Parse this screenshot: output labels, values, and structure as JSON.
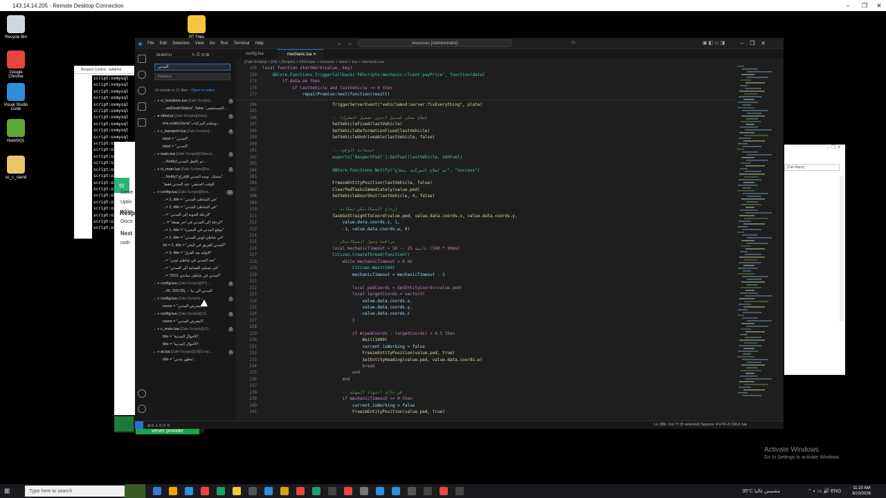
{
  "rdp": {
    "title": "143.14.14.205 - Remote Desktop Connection"
  },
  "desktop": {
    "icons": [
      {
        "label": "Recycle Bin",
        "color": "#cfd8dc"
      },
      {
        "label": "RT Files",
        "color": "#f5c542"
      },
      {
        "label": "Google Chrome",
        "color": "#e8453c"
      },
      {
        "label": "Visual Studio Code",
        "color": "#2d8fdd"
      },
      {
        "label": "HeidiSQL",
        "color": "#5aa832"
      },
      {
        "label": "sc_c_stand",
        "color": "#e9c46a"
      }
    ]
  },
  "respect_window": {
    "title": "Respect Control - txAdmin",
    "console_line": "script:oxmysql"
  },
  "browser_panel": {
    "heading": "Resp",
    "labels": [
      "Serve",
      "Uptin",
      "White",
      "Disco",
      "Next",
      "noth"
    ],
    "server_provider": "server provider"
  },
  "right_window": {
    "search_value": "[Zali-Maps]"
  },
  "vscode": {
    "menu": [
      "File",
      "Edit",
      "Selection",
      "View",
      "Go",
      "Run",
      "Terminal",
      "Help"
    ],
    "command_center": "resources [Administrator]",
    "search": {
      "title": "SEARCH",
      "query": "المدني",
      "replace_placeholder": "Replace",
      "results_summary": "24 results in 11 files - ",
      "open_in_editor": "Open in editor"
    },
    "tree": [
      {
        "file": "cl_functions.lua",
        "path": "[Zaki-Scripts]...",
        "count": "1",
        "level": 0
      },
      {
        "file": "...setDeathStatus\", false, 'المستشفى...",
        "level": 1
      },
      {
        "file": "client.js",
        "path": "[Zaki-Scripts][Jobs]...",
        "count": "1",
        "level": 0
      },
      {
        "file": "this.notifyClient(\"وصلتم المركبات...",
        "level": 1
      },
      {
        "file": "c_transport.lua",
        "path": "[Zaki-Scripts]...",
        "count": "2",
        "level": 0
      },
      {
        "file": "label = \"المدني\",",
        "level": 1
      },
      {
        "file": "label = \"المدني\",",
        "level": 1
      },
      {
        "file": "main.lua",
        "path": "[Zaki-Scripts][Others]...",
        "count": "1",
        "level": 0
      },
      {
        "file": "...Notify('تم بالنقل المدني...",
        "level": 1
      },
      {
        "file": "cl_main.lua",
        "path": "[Zaki-Scripts][Re...",
        "count": "2",
        "level": 0
      },
      {
        "file": "...Notify(\"سجنك. توجه المدني للإفراج\"",
        "level": 1
      },
      {
        "file": "\"الوقت المتبقي: عند المدني فقط",
        "level": 1
      },
      {
        "file": "config.lua",
        "path": "[Zaki-Scripts][Res...",
        "count": "12",
        "level": 0
      },
      {
        "file": "...= 2, title = \"في الشاطئ المدني\"",
        "level": 1
      },
      {
        "file": "...= 2, title = \"في الشاطئ المدني\"",
        "level": 1
      },
      {
        "file": "...= \"الرحلة الجوية إلى المدني\"",
        "level": 1
      },
      {
        "file": "... = \"الرحلة إلى المدني في اخر نقطة\"",
        "level": 1
      },
      {
        "file": "...= 1, title = \"موقع المدني في البحيرة\"",
        "level": 1
      },
      {
        "file": "...= 2, title = \"في شاطئ لوس المدني\"",
        "level": 1
      },
      {
        "file": "(id = 2, title = \"المدني الغريق في البحر\"",
        "level": 1
      },
      {
        "file": "...= 3, title = \"الاولية بعد الغرق\"",
        "level": 1
      },
      {
        "file": "...= \"تحد المدني في شاطئ لوس\"",
        "level": 1
      },
      {
        "file": "...= \"قم بتسليم القمامة الى المدني\"",
        "level": 1
      },
      {
        "file": "...= \"المدني في شاطئ ساندي 2011\"",
        "level": 1
      },
      {
        "file": "config.lua",
        "path": "[Zaki-Scripts][RT]...",
        "count": "1",
        "level": 0
      },
      {
        "file": "...99, 259.09), -- المدني الي بيا",
        "level": 1
      },
      {
        "file": "config.lua",
        "path": "[Zaki-Scripts]...",
        "count": "1",
        "level": 0
      },
      {
        "file": "name = \"المعرض المدني\",",
        "level": 1
      },
      {
        "file": "config.lua",
        "path": "[Zaki-Scripts][UI]...",
        "count": "1",
        "level": 0
      },
      {
        "file": "name = \"المعرض المدني\",",
        "level": 1
      },
      {
        "file": "c_main.lua",
        "path": "[Zaki-Scripts][UI]...",
        "count": "2",
        "level": 0
      },
      {
        "file": "title = \"الأحوال المدنية\",",
        "level": 1
      },
      {
        "file": "title = \"الأحوال المدنية\",",
        "level": 1
      },
      {
        "file": "ar.lua",
        "path": "[Zaki-Scripts][UI][Scrip...",
        "count": "1",
        "level": 0
      },
      {
        "file": "title = \"مظهر مدني\",",
        "level": 1
      }
    ],
    "tabs": [
      {
        "label": "config.lua"
      },
      {
        "label": "mechanic.lua"
      }
    ],
    "breadcrumb": "[Zaki-Scripts] > [UI] > [Scripts] > F8Scripts > resource > client > lua > mechanic.lua",
    "sticky_lines": [
      {
        "n": "158",
        "t": "local function startWork(value, key)"
      },
      {
        "n": "159",
        "t": "    QBCore.Functions.TriggerCallback('F8Scripts:mechanic:client:payPrice', function(data)"
      },
      {
        "n": "175",
        "t": "        if data.ok then"
      },
      {
        "n": "176",
        "t": "            if lastVehicle and lastVehicle ~= 0 then"
      },
      {
        "n": "177",
        "t": "                repairPromise:next(function(result)"
      }
    ],
    "code": [
      {
        "n": "194",
        "t": "                            TriggerServerEvent(\"vehiclemod:server:fixEverything\", plate)"
      },
      {
        "n": "195",
        "t": ""
      },
      {
        "n": "196",
        "t": "                            -- إصلاح محلي كسبيل (بدون تفعيل المحرك)"
      },
      {
        "n": "197",
        "t": "                            SetVehicleFixed(lastVehicle)"
      },
      {
        "n": "198",
        "t": "                            SetVehicleDeformationFixed(lastVehicle)"
      },
      {
        "n": "199",
        "t": "                            SetVehicleUndriveable(lastVehicle, false)"
      },
      {
        "n": "200",
        "t": ""
      },
      {
        "n": "201",
        "t": "                            -- استعادة الوقود"
      },
      {
        "n": "202",
        "t": "                            exports['RespectFuel']:SetFuel(lastVehicle, VehFuel)"
      },
      {
        "n": "203",
        "t": ""
      },
      {
        "n": "204",
        "t": "                            QBCore.Functions.Notify(\"تم إصلاح المركبة بنجاح\", \"success\")"
      },
      {
        "n": "205",
        "t": ""
      },
      {
        "n": "206",
        "t": "                            FreezeEntityPosition(lastVehicle, false)"
      },
      {
        "n": "207",
        "t": "                            ClearPedTasksImmediately(value.ped)"
      },
      {
        "n": "208",
        "t": "                            SetVehicleDoorShut(lastVehicle, 4, false)"
      },
      {
        "n": "209",
        "t": ""
      },
      {
        "n": "210",
        "t": "                            -- إرجاع الميكانيكي لمكانه"
      },
      {
        "n": "211",
        "t": "                            TaskGoStraightToCoord(value.ped, value.data.coords.x, value.data.coords.y,"
      },
      {
        "n": "212",
        "t": "                                value.data.coords.z, 1,"
      },
      {
        "n": "213",
        "t": "                                -1, value.data.coords.w, 0)"
      },
      {
        "n": "214",
        "t": ""
      },
      {
        "n": "215",
        "t": "                            -- مراقبة وصول الميكانيكي"
      },
      {
        "n": "216",
        "t": "                            local mechanicTimeout = 50 -- 25 ثانية (50 * 500ms)"
      },
      {
        "n": "217",
        "t": "                            Citizen.CreateThread(function()"
      },
      {
        "n": "218",
        "t": "                                while mechanicTimeout > 0 do"
      },
      {
        "n": "219",
        "t": "                                    Citizen.Wait(500)"
      },
      {
        "n": "220",
        "t": "                                    mechanicTimeout = mechanicTimeout - 1"
      },
      {
        "n": "221",
        "t": ""
      },
      {
        "n": "222",
        "t": "                                    local pedCoords = GetEntityCoords(value.ped)"
      },
      {
        "n": "223",
        "t": "                                    local targetCoords = vector3("
      },
      {
        "n": "224",
        "t": "                                        value.data.coords.x,"
      },
      {
        "n": "225",
        "t": "                                        value.data.coords.y,"
      },
      {
        "n": "226",
        "t": "                                        value.data.coords.z"
      },
      {
        "n": "227",
        "t": "                                    )"
      },
      {
        "n": "228",
        "t": ""
      },
      {
        "n": "229",
        "t": "                                    if #(pedCoords - targetCoords) < 0.5 then"
      },
      {
        "n": "230",
        "t": "                                        Wait(1000)"
      },
      {
        "n": "231",
        "t": "                                        current.isWorking = false"
      },
      {
        "n": "232",
        "t": "                                        FreezeEntityPosition(value.ped, true)"
      },
      {
        "n": "233",
        "t": "                                        SetEntityHeading(value.ped, value.data.coords.w)"
      },
      {
        "n": "234",
        "t": "                                        break"
      },
      {
        "n": "235",
        "t": "                                    end"
      },
      {
        "n": "236",
        "t": "                                end"
      },
      {
        "n": "237",
        "t": ""
      },
      {
        "n": "238",
        "t": "                                -- في حالة انتهاء المهلة"
      },
      {
        "n": "239",
        "t": "                                if mechanicTimeout <= 0 then"
      },
      {
        "n": "240",
        "t": "                                    current.isWorking = false"
      },
      {
        "n": "241",
        "t": "                                    FreezeEntityPosition(value.ped, true)"
      }
    ],
    "status_left": "⊗ 0  ⚠ 0    ⓦ 0",
    "status_right": "Ln 389, Col 77 (8 selected)   Spaces: 4   UTF-8   CRLF   lua"
  },
  "watermark": {
    "line1": "Activate Windows",
    "line2": "Go to Settings to activate Windows."
  },
  "taskbar": {
    "search_placeholder": "Type here to search",
    "weather": "35°C  مشمس غالبا",
    "time": "11:10 AM",
    "date": "8/10/2026"
  }
}
